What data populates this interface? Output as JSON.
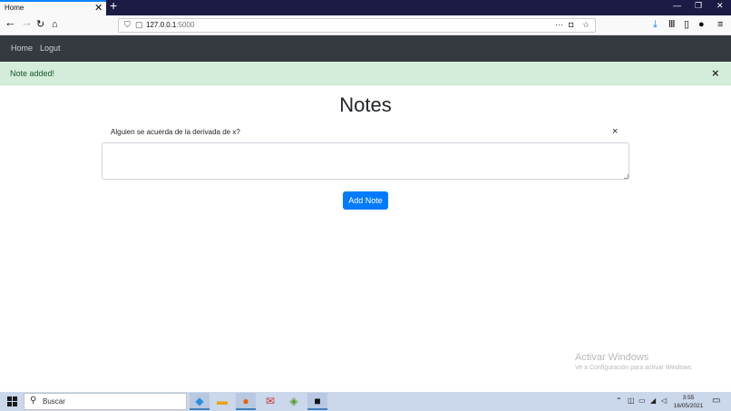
{
  "browser": {
    "tab_title": "Home",
    "tab_close": "✕",
    "new_tab": "+",
    "url_host": "127.0.0.1",
    "url_port": ":5000",
    "window_controls": [
      "—",
      "❐",
      "✕"
    ]
  },
  "app_nav": {
    "links": [
      "Home",
      "Logut"
    ]
  },
  "alert": {
    "message": "Note added!",
    "close": "×",
    "color": "#d4edda"
  },
  "main": {
    "title": "Notes",
    "notes": [
      {
        "text": "Alguien se acuerda de la derivada de x?",
        "delete": "×"
      }
    ],
    "textarea_value": "",
    "add_button": "Add Note",
    "accent": "#007bff"
  },
  "watermark": {
    "title": "Activar Windows",
    "subtitle": "Ve a Configuración para activar Windows."
  },
  "taskbar": {
    "search_placeholder": "Buscar",
    "apps": [
      "vscode-icon",
      "file-explorer-icon",
      "firefox-icon",
      "mail-icon",
      "python-icon",
      "terminal-icon"
    ],
    "time": "3:55",
    "date": "16/05/2021"
  }
}
